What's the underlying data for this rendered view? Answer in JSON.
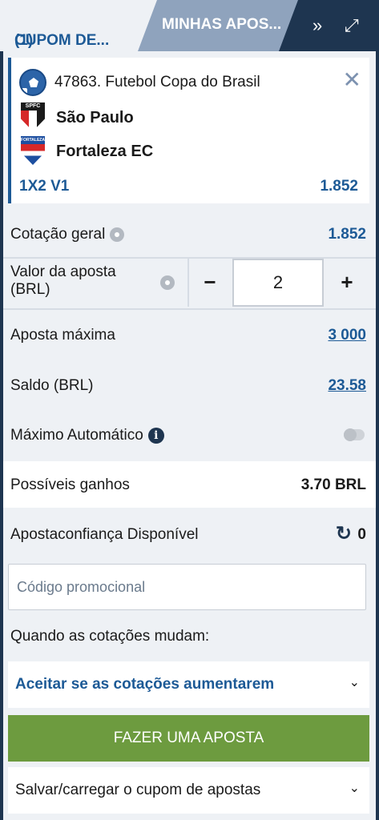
{
  "tabs": {
    "active_label": "CUPOM DE...",
    "active_count": "(1)",
    "inactive_label": "MINHAS APOS...",
    "more_icon": "»",
    "expand_icon": "⤢"
  },
  "bet": {
    "event": "47863. Futebol Copa do Brasil",
    "home_team": "São Paulo",
    "away_team": "Fortaleza EC",
    "home_badge_text": "SPFC",
    "away_badge_text": "FORTALEZA",
    "market": "1X2 V1",
    "odd": "1.852",
    "close_icon": "✕"
  },
  "summary": {
    "total_odds_label": "Cotação geral",
    "total_odds_value": "1.852",
    "stake_label_line1": "Valor da aposta",
    "stake_label_line2": "(BRL)",
    "stake_value": "2",
    "minus": "−",
    "plus": "+",
    "max_bet_label": "Aposta máxima",
    "max_bet_value": "3 000",
    "balance_label": "Saldo (BRL)",
    "balance_value": "23.58",
    "auto_max_label": "Máximo Automático",
    "auto_max_enabled": false,
    "possible_win_label": "Possíveis ganhos",
    "possible_win_value": "3.70 BRL",
    "trust_bet_label": "Apostaconfiança Disponível",
    "trust_bet_value": "0",
    "promo_placeholder": "Código promocional",
    "odds_change_label": "Quando as cotações mudam:",
    "odds_change_option": "Aceitar se as cotações aumentarem",
    "place_bet_label": "FAZER UMA APOSTA",
    "save_load_label": "Salvar/carregar o cupom de apostas"
  },
  "colors": {
    "brand_dark": "#1e3550",
    "accent_blue": "#1d5a96",
    "button_green": "#6d9b3f"
  }
}
